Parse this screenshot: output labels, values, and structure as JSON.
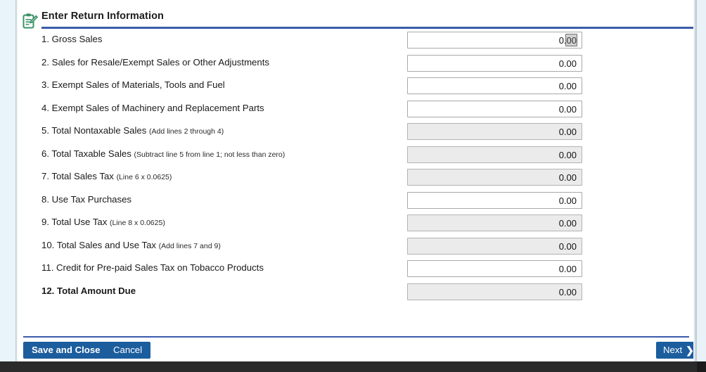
{
  "header": {
    "icon": "clipboard-pencil-icon",
    "title": "Enter Return Information",
    "rule_color": "#3a5cab"
  },
  "form": {
    "rows": [
      {
        "label": "1. Gross Sales",
        "hint": "",
        "bold": false,
        "value": "0.00",
        "readonly": false,
        "focused": true
      },
      {
        "label": "2. Sales for Resale/Exempt Sales or Other Adjustments",
        "hint": "",
        "bold": false,
        "value": "0.00",
        "readonly": false,
        "focused": false
      },
      {
        "label": "3. Exempt Sales of Materials, Tools and Fuel",
        "hint": "",
        "bold": false,
        "value": "0.00",
        "readonly": false,
        "focused": false
      },
      {
        "label": "4. Exempt Sales of Machinery and Replacement Parts",
        "hint": "",
        "bold": false,
        "value": "0.00",
        "readonly": false,
        "focused": false
      },
      {
        "label": "5. Total Nontaxable Sales",
        "hint": "(Add lines 2 through 4)",
        "bold": false,
        "value": "0.00",
        "readonly": true,
        "focused": false
      },
      {
        "label": "6. Total Taxable Sales",
        "hint": "(Subtract line 5 from line 1; not less than zero)",
        "bold": false,
        "value": "0.00",
        "readonly": true,
        "focused": false
      },
      {
        "label": "7. Total Sales Tax",
        "hint": "(Line 6 x 0.0625)",
        "bold": false,
        "value": "0.00",
        "readonly": true,
        "focused": false
      },
      {
        "label": "8. Use Tax Purchases",
        "hint": "",
        "bold": false,
        "value": "0.00",
        "readonly": false,
        "focused": false
      },
      {
        "label": "9. Total Use Tax",
        "hint": "(Line 8 x 0.0625)",
        "bold": false,
        "value": "0.00",
        "readonly": true,
        "focused": false
      },
      {
        "label": "10. Total Sales and Use Tax",
        "hint": "(Add lines 7 and 9)",
        "bold": false,
        "value": "0.00",
        "readonly": true,
        "focused": false
      },
      {
        "label": "11. Credit for Pre-paid Sales Tax on Tobacco Products",
        "hint": "",
        "bold": false,
        "value": "0.00",
        "readonly": false,
        "focused": false
      },
      {
        "label": "12. Total Amount Due",
        "hint": "",
        "bold": true,
        "value": "0.00",
        "readonly": true,
        "focused": false
      }
    ]
  },
  "footer": {
    "save_label": "Save and Close",
    "cancel_label": "Cancel",
    "next_label": "Next",
    "next_icon": "chevron-right-icon",
    "button_color": "#1c5d9e"
  }
}
